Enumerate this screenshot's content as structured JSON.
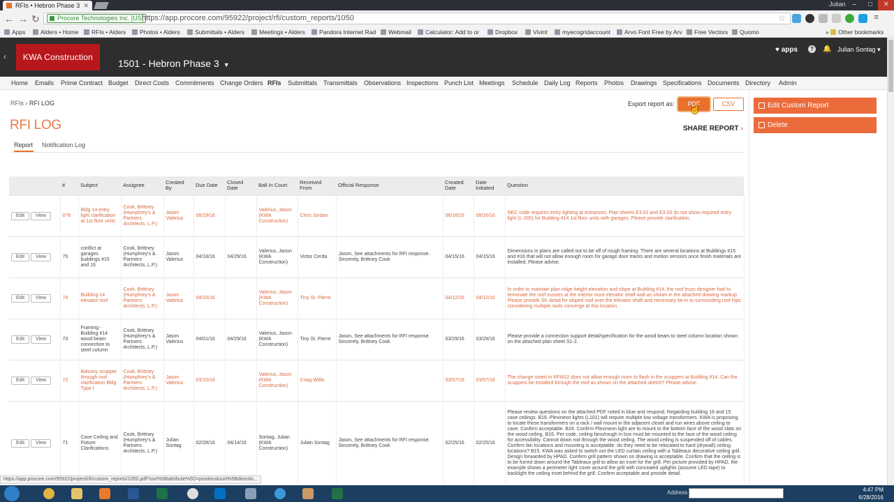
{
  "browser": {
    "tab_title": "RFIs • Hebron Phase 3",
    "user": "Julian",
    "secure_label": "Procore Technologies Inc. [US]",
    "url": "https://app.procore.com/95922/project/rfi/custom_reports/1050",
    "bookmarks": [
      "Apps",
      "Alders • Home",
      "RFIs • Alders",
      "Photos • Alders",
      "Submittals • Alders",
      "Meetings • Alders",
      "Pandora Internet Rad",
      "Webmail",
      "Calculator: Add to or",
      "Dropbox",
      "Vivint",
      "myecogridaccount",
      "Arvo Font Free by Arv",
      "Free Vectors",
      "Quomo",
      "Other bookmarks"
    ]
  },
  "header": {
    "logo": "KWA Construction",
    "project": "1501 - Hebron Phase 3",
    "apps": "apps",
    "user": "Julian Sontag"
  },
  "nav": [
    "Home",
    "Emails",
    "Prime Contract",
    "Budget",
    "Direct Costs",
    "Commitments",
    "Change Orders",
    "RFIs",
    "Submittals",
    "Transmittals",
    "Observations",
    "Inspections",
    "Punch List",
    "Meetings",
    "Schedule",
    "Daily Log",
    "Reports",
    "Photos",
    "Drawings",
    "Specifications",
    "Documents",
    "Directory",
    "Admin"
  ],
  "page": {
    "breadcrumb_root": "RFIs",
    "breadcrumb_current": "RFI LOG",
    "title": "RFI LOG",
    "tab_report": "Report",
    "tab_notification": "Notification Log",
    "export_label": "Export report as:",
    "pdf": "PDF",
    "csv": "CSV",
    "share": "SHARE REPORT",
    "edit_report": "Edit Custom Report",
    "delete": "Delete"
  },
  "table": {
    "edit_label": "Edit",
    "view_label": "View",
    "headers": [
      "",
      "#",
      "Subject",
      "Assignee",
      "Created By",
      "Due Date",
      "Closed Date",
      "Ball In Court",
      "Received From",
      "Official Response",
      "Created Date",
      "Date Initiated",
      "Question"
    ],
    "rows": [
      {
        "num": "076",
        "subject": "Bldg 14 entry light clarification at 1st floor units",
        "assignee": "Cook, Brittney (Humphrey's & Partners Architects, L.P.)",
        "created_by": "Jason Valerius",
        "due": "06/19/16",
        "closed": "",
        "ball": "Valerius, Jason (KWA Construction)",
        "received": "Chris Jordan",
        "response": "",
        "created": "06/16/16",
        "initiated": "06/16/16",
        "question": "NEC code requires entry lighting at entrances. Plan sheets E3.01 and E3.03 do not show required entry light (L-200) for Building #14 1st floor units with garages. Please provide clarification."
      },
      {
        "num": "75",
        "subject": "conflict at garages buildings #15 and 16",
        "assignee": "Cook, Brittney (Humphrey's & Partners Architects, L.P.)",
        "created_by": "Jason Valerius",
        "due": "04/18/16",
        "closed": "04/29/16",
        "ball": "Valerius, Jason (KWA Construction)",
        "received": "Victor Cerda",
        "response": "Jason, See attachments for RFI response. Sincerely, Brittney Cook",
        "created": "04/15/16",
        "initiated": "04/15/16",
        "question": "Dimensions in plans are called out to be off of rough framing. There are several locations at Buildings #15 and #16 that will not allow enough room for garage door tracks and motion sensors once finish materials are installed. Please advise."
      },
      {
        "num": "74",
        "subject": "Building 14 elevator roof",
        "assignee": "Cook, Brittney (Humphrey's & Partners Architects, L.P.)",
        "created_by": "Jason Valerius",
        "due": "04/15/16",
        "closed": "",
        "ball": "Valerius, Jason (KWA Construction)",
        "received": "Tiny St. Pierre",
        "response": "",
        "created": "04/12/16",
        "initiated": "04/12/16",
        "question": "In order to maintain plan ridge height elevation and slope at Building #14, the roof truss designer had to terminate the roof trusses at the interior most elevator shaft wall as shown in the attached drawing markup. Please provide SK detail for sloped roof over the elevator shaft and necessary tie-in to surrounding roof hips considering multiple roofs converge at this location."
      },
      {
        "num": "73",
        "subject": "Framing - Building #14 wood beam connection to steel column",
        "assignee": "Cook, Brittney (Humphrey's & Partners Architects, L.P.)",
        "created_by": "Jason Valerius",
        "due": "04/01/16",
        "closed": "04/29/16",
        "ball": "Valerius, Jason (KWA Construction)",
        "received": "Tiny St. Pierre",
        "response": "Jason, See attachments for RFI response. Sincerely, Brittney Cook",
        "created": "03/29/16",
        "initiated": "03/29/16",
        "question": "Please provide a connection support detail/specification for the wood beam to steel column location shown on the attached plan sheet S1-2."
      },
      {
        "num": "72",
        "subject": "Balcony scupper through roof clarification Bldg Type I",
        "assignee": "Cook, Brittney (Humphrey's & Partners Architects, L.P.)",
        "created_by": "Jason Valerius",
        "due": "03/10/16",
        "closed": "",
        "ball": "Valerius, Jason (KWA Construction)",
        "received": "Craig Willis",
        "response": "",
        "created": "03/07/16",
        "initiated": "03/07/16",
        "question": "The change noted in RFI#22 does not allow enough room to flash in the scuppers at Building #14. Can the scuppers be installed through the roof as shown on the attached sketch? Please advise."
      },
      {
        "num": "71",
        "subject": "Cave Ceiling and Fixture Clarifications",
        "assignee": "Cook, Brittney (Humphrey's & Partners Architects, L.P.)",
        "created_by": "Julian Sontag",
        "due": "02/28/16",
        "closed": "04/14/16",
        "ball": "Sontag, Julian (KWA Construction)",
        "received": "Julian Sontag",
        "response": "Jason, See attachments for RFI response. Sincerely, Brittney Cook",
        "created": "02/25/16",
        "initiated": "02/25/16",
        "question": "Please review questions on the attached PDF noted in blue and respond. Regarding building 16 and 15 cave ceilings. B16. Plexineon lights (L101) will require multiple low voltage transformers. KWA is proposing to locate these transformers on a rack / wall mount in the adjacent closet and run wires above ceiling to cave. Confirm acceptable. B16. Confirm Plexineon light are to mount to the bottom face of the wood slats on the wood ceiling. B16. Per code, ceiling fans/rough in box must be mounted to the face of the wood ceiling for accessibility. Cannot down rod through the wood ceiling. The wood ceiling is suspended off of cables. Confirm fan locations and mounting is acceptable. do they need to be relocated to hard (drywall) ceiling locations? B15. KWA was asked to switch out the LED curtain ceiling with a Tableaux decorative ceiling grill. Design forwarded by HPAD. Confirm grill pattern shown on drawing is acceptable. Confirm that the ceiling is to be furred down around the Tableaux grill to allow an inset for the grill. Per picture provided by HPAD, the example shows a perimeter light cover around the grill with concealed uplights (assume LED tape) to backlight the ceiling inset behind the grill. Confirm acceptable and provide detail."
      }
    ]
  },
  "status_url": "https://app.procore.com/95922/project/rfi/custom_reports/1050.pdf?sort%5Battribute%5D=position&sort%5Bdirectio...",
  "taskbar": {
    "address_label": "Address",
    "time": "4:47 PM",
    "date": "6/28/2016"
  }
}
